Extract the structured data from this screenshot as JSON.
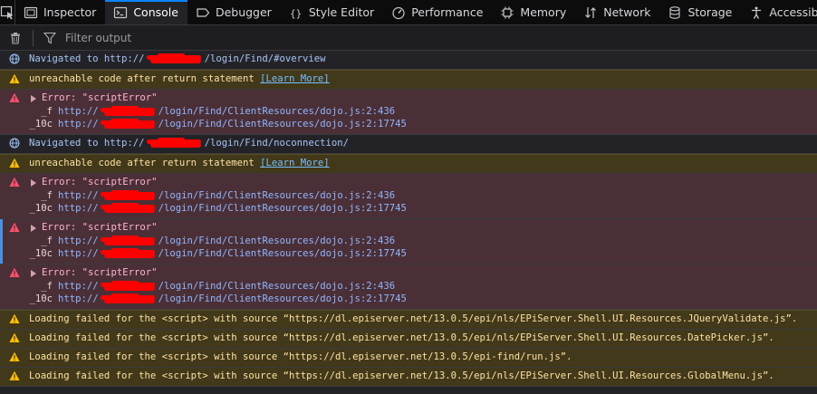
{
  "tabs": [
    {
      "label": "Inspector",
      "icon": "inspector-icon"
    },
    {
      "label": "Console",
      "icon": "console-icon",
      "active": true
    },
    {
      "label": "Debugger",
      "icon": "debugger-icon"
    },
    {
      "label": "Style Editor",
      "icon": "style-editor-icon"
    },
    {
      "label": "Performance",
      "icon": "performance-icon"
    },
    {
      "label": "Memory",
      "icon": "memory-icon"
    },
    {
      "label": "Network",
      "icon": "network-icon"
    },
    {
      "label": "Storage",
      "icon": "storage-icon"
    },
    {
      "label": "Accessibility",
      "icon": "accessibility-icon"
    }
  ],
  "filter": {
    "placeholder": "Filter output"
  },
  "colors": {
    "accent": "#0a84ff",
    "warning_bg": "#42381a",
    "error_bg": "#4b2f36",
    "link": "#75bfff",
    "redaction": "#ff0000"
  },
  "messages": [
    {
      "type": "nav",
      "prefix": "Navigated to http://",
      "suffix": "/login/Find/#overview"
    },
    {
      "type": "warn",
      "text": "unreachable code after return statement",
      "link": "[Learn More]"
    },
    {
      "type": "error",
      "title": "Error: \"scriptError\"",
      "stack": [
        {
          "fn": "_f",
          "prefix": "http://",
          "suffix": "/login/Find/ClientResources/dojo.js:2:436"
        },
        {
          "fn": "_10c",
          "prefix": "http://",
          "suffix": "/login/Find/ClientResources/dojo.js:2:17745"
        }
      ]
    },
    {
      "type": "nav",
      "prefix": "Navigated to http://",
      "suffix": "/login/Find/noconnection/"
    },
    {
      "type": "warn",
      "text": "unreachable code after return statement",
      "link": "[Learn More]"
    },
    {
      "type": "error",
      "title": "Error: \"scriptError\"",
      "stack": [
        {
          "fn": "_f",
          "prefix": "http://",
          "suffix": "/login/Find/ClientResources/dojo.js:2:436"
        },
        {
          "fn": "_10c",
          "prefix": "http://",
          "suffix": "/login/Find/ClientResources/dojo.js:2:17745"
        }
      ]
    },
    {
      "type": "error",
      "selected": true,
      "title": "Error: \"scriptError\"",
      "stack": [
        {
          "fn": "_f",
          "prefix": "http://",
          "suffix": "/login/Find/ClientResources/dojo.js:2:436"
        },
        {
          "fn": "_10c",
          "prefix": "http://",
          "suffix": "/login/Find/ClientResources/dojo.js:2:17745"
        }
      ]
    },
    {
      "type": "error",
      "title": "Error: \"scriptError\"",
      "stack": [
        {
          "fn": "_f",
          "prefix": "http://",
          "suffix": "/login/Find/ClientResources/dojo.js:2:436"
        },
        {
          "fn": "_10c",
          "prefix": "http://",
          "suffix": "/login/Find/ClientResources/dojo.js:2:17745"
        }
      ]
    },
    {
      "type": "warn",
      "text": "Loading failed for the <script> with source “https://dl.episerver.net/13.0.5/epi/nls/EPiServer.Shell.UI.Resources.JQueryValidate.js”."
    },
    {
      "type": "warn",
      "text": "Loading failed for the <script> with source “https://dl.episerver.net/13.0.5/epi/nls/EPiServer.Shell.UI.Resources.DatePicker.js”."
    },
    {
      "type": "warn",
      "text": "Loading failed for the <script> with source “https://dl.episerver.net/13.0.5/epi-find/run.js”."
    },
    {
      "type": "warn",
      "text": "Loading failed for the <script> with source “https://dl.episerver.net/13.0.5/epi/nls/EPiServer.Shell.UI.Resources.GlobalMenu.js”."
    }
  ]
}
